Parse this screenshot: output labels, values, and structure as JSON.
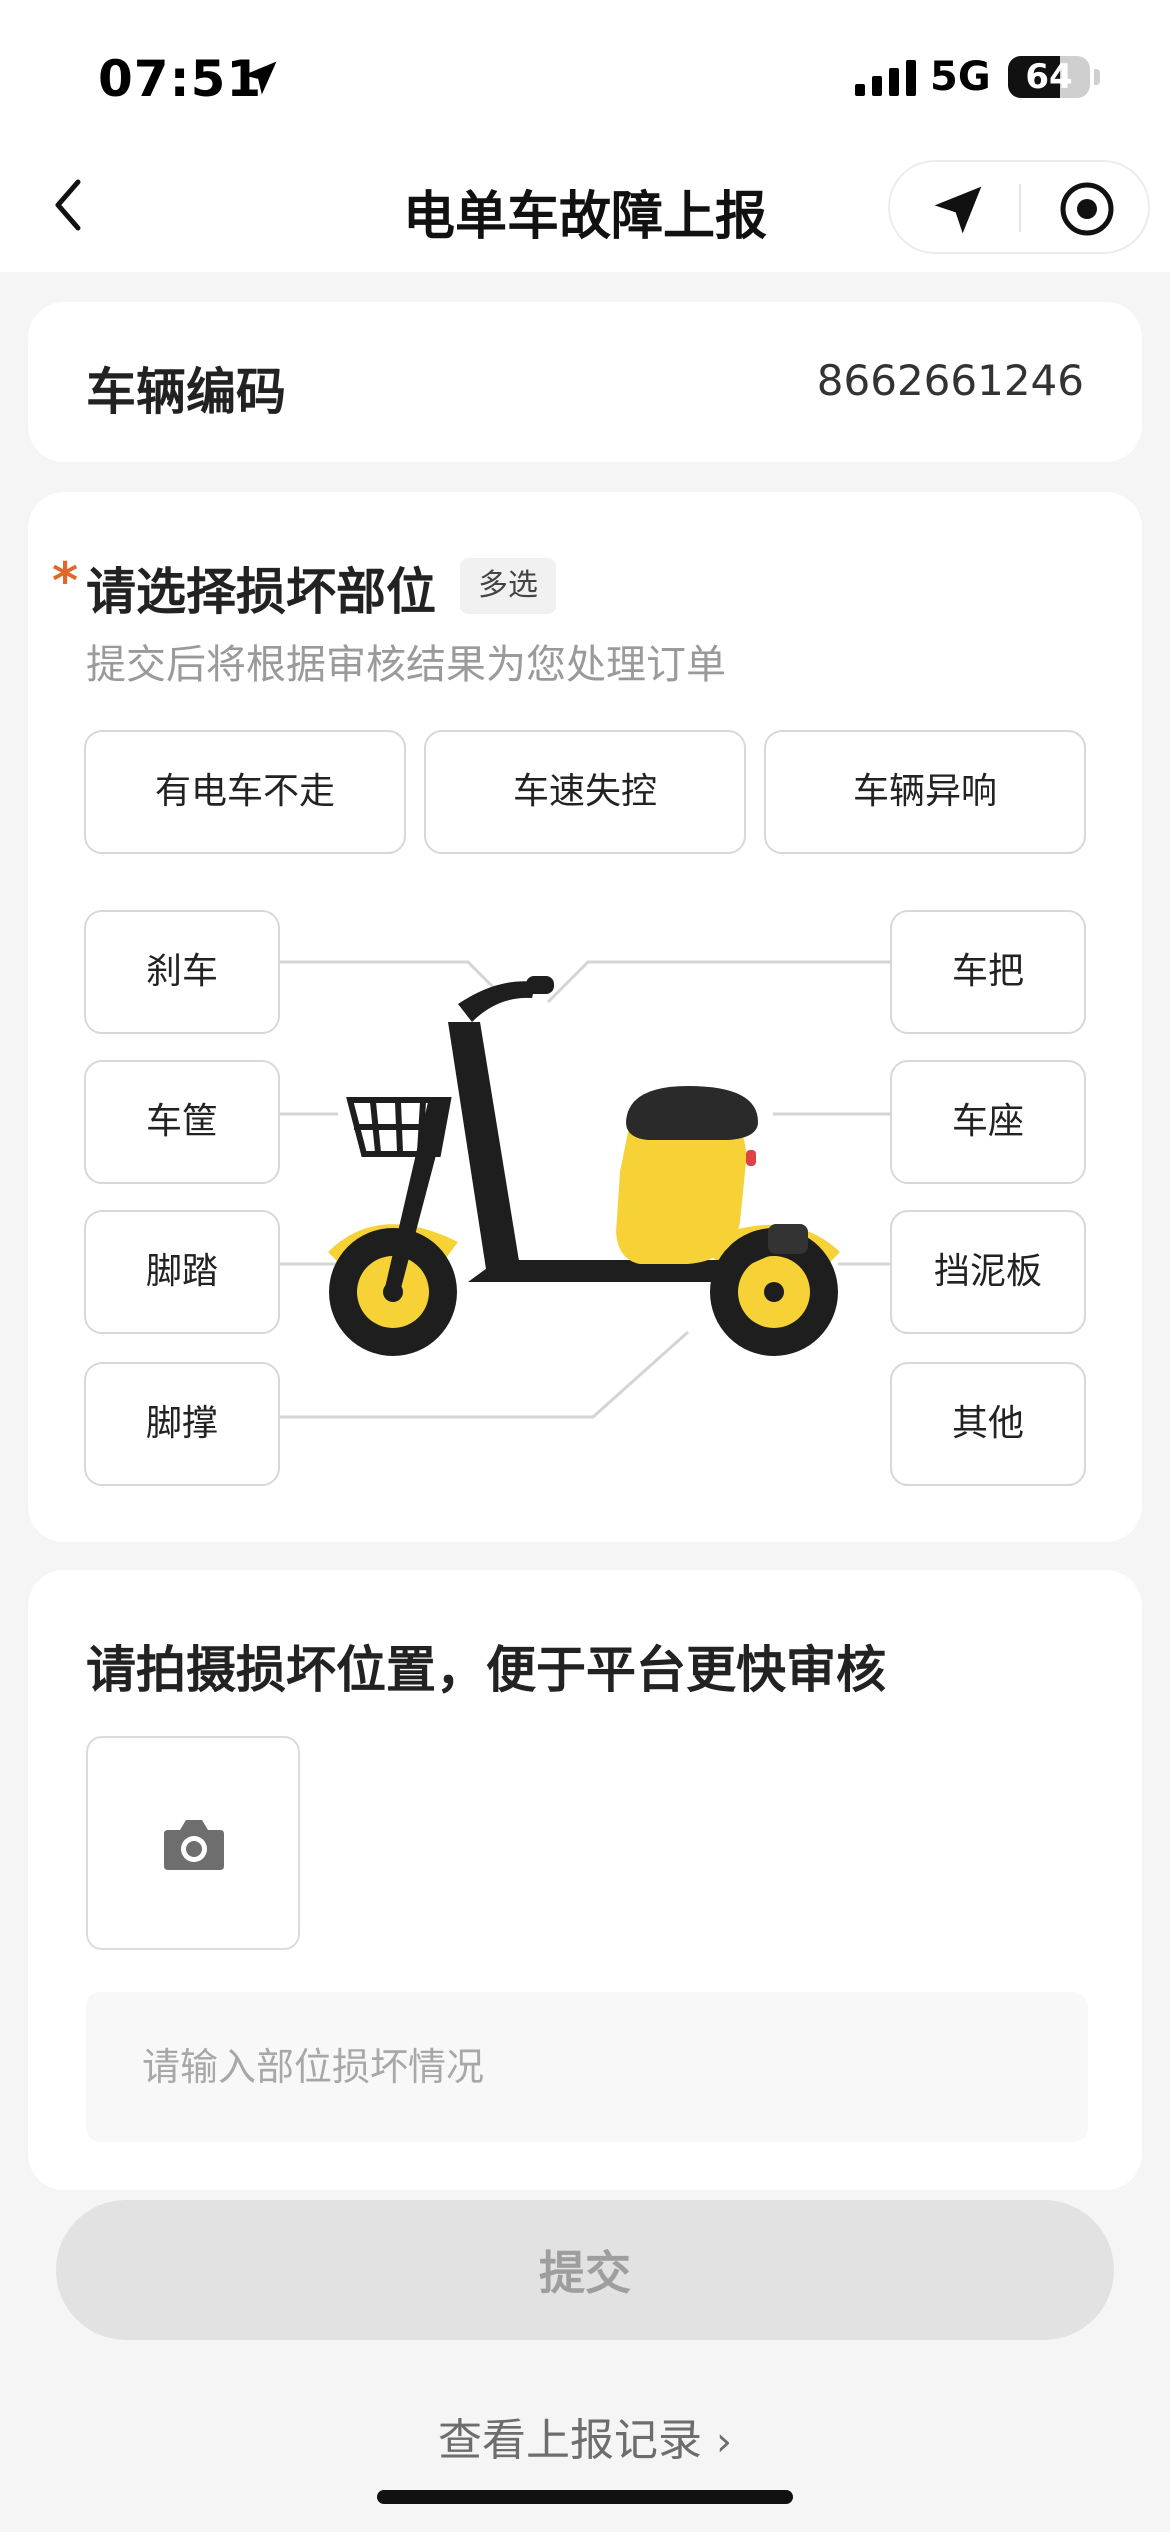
{
  "status_bar": {
    "time": "07:51",
    "network": "5G",
    "battery": "64",
    "battery_level": 0.64
  },
  "header": {
    "title": "电单车故障上报",
    "back_icon": "chevron-left-icon",
    "capsule_icons": [
      "navigation-arrow-icon",
      "target-record-icon"
    ]
  },
  "vehicle": {
    "label": "车辆编码",
    "code": "8662661246"
  },
  "damage": {
    "required_mark": "*",
    "title": "请选择损坏部位",
    "tag": "多选",
    "hint": "提交后将根据审核结果为您处理订单",
    "general_options": [
      "有电车不走",
      "车速失控",
      "车辆异响"
    ],
    "left_parts": [
      "刹车",
      "车筐",
      "脚踏",
      "脚撑"
    ],
    "right_parts": [
      "车把",
      "车座",
      "挡泥板",
      "其他"
    ]
  },
  "photo": {
    "title": "请拍摄损坏位置，便于平台更快审核",
    "camera_icon": "camera-icon",
    "input_placeholder": "请输入部位损坏情况"
  },
  "submit_label": "提交",
  "records_link": "查看上报记录",
  "records_chevron": "›",
  "colors": {
    "accent_star": "#e2662b",
    "scooter_yellow": "#f6d236",
    "scooter_black": "#1e1e1e"
  }
}
